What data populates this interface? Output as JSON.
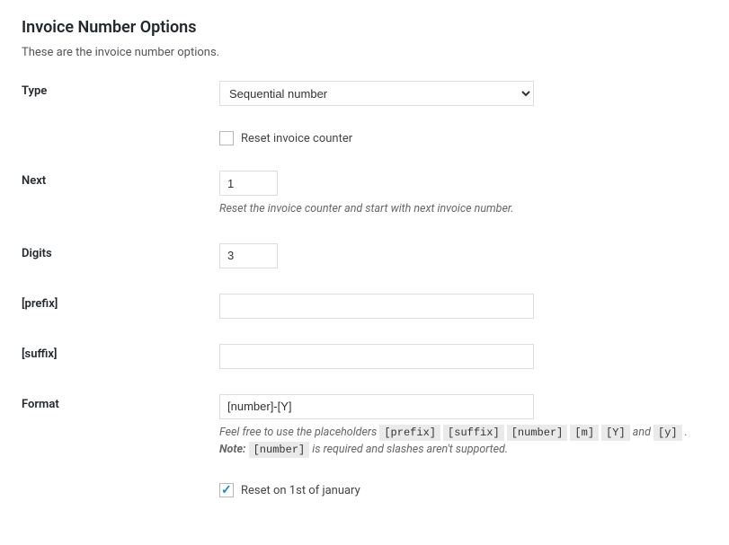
{
  "section": {
    "title": "Invoice Number Options",
    "description": "These are the invoice number options."
  },
  "fields": {
    "type": {
      "label": "Type",
      "value": "Sequential number"
    },
    "reset_counter": {
      "label": "Reset invoice counter",
      "checked": false
    },
    "next": {
      "label": "Next",
      "value": "1",
      "hint": "Reset the invoice counter and start with next invoice number."
    },
    "digits": {
      "label": "Digits",
      "value": "3"
    },
    "prefix": {
      "label": "[prefix]",
      "value": ""
    },
    "suffix": {
      "label": "[suffix]",
      "value": ""
    },
    "format": {
      "label": "Format",
      "value": "[number]-[Y]",
      "hint_prefix": "Feel free to use the placeholders ",
      "placeholders": {
        "p1": "[prefix]",
        "p2": "[suffix]",
        "p3": "[number]",
        "p4": "[m]",
        "p5": "[Y]",
        "p6": "[y]"
      },
      "hint_and": " and ",
      "hint_period": " .",
      "note_label": "Note:",
      "note_code": "[number]",
      "note_suffix": " is required and slashes aren't supported."
    },
    "reset_jan": {
      "label": "Reset on 1st of january",
      "checked": true
    }
  }
}
